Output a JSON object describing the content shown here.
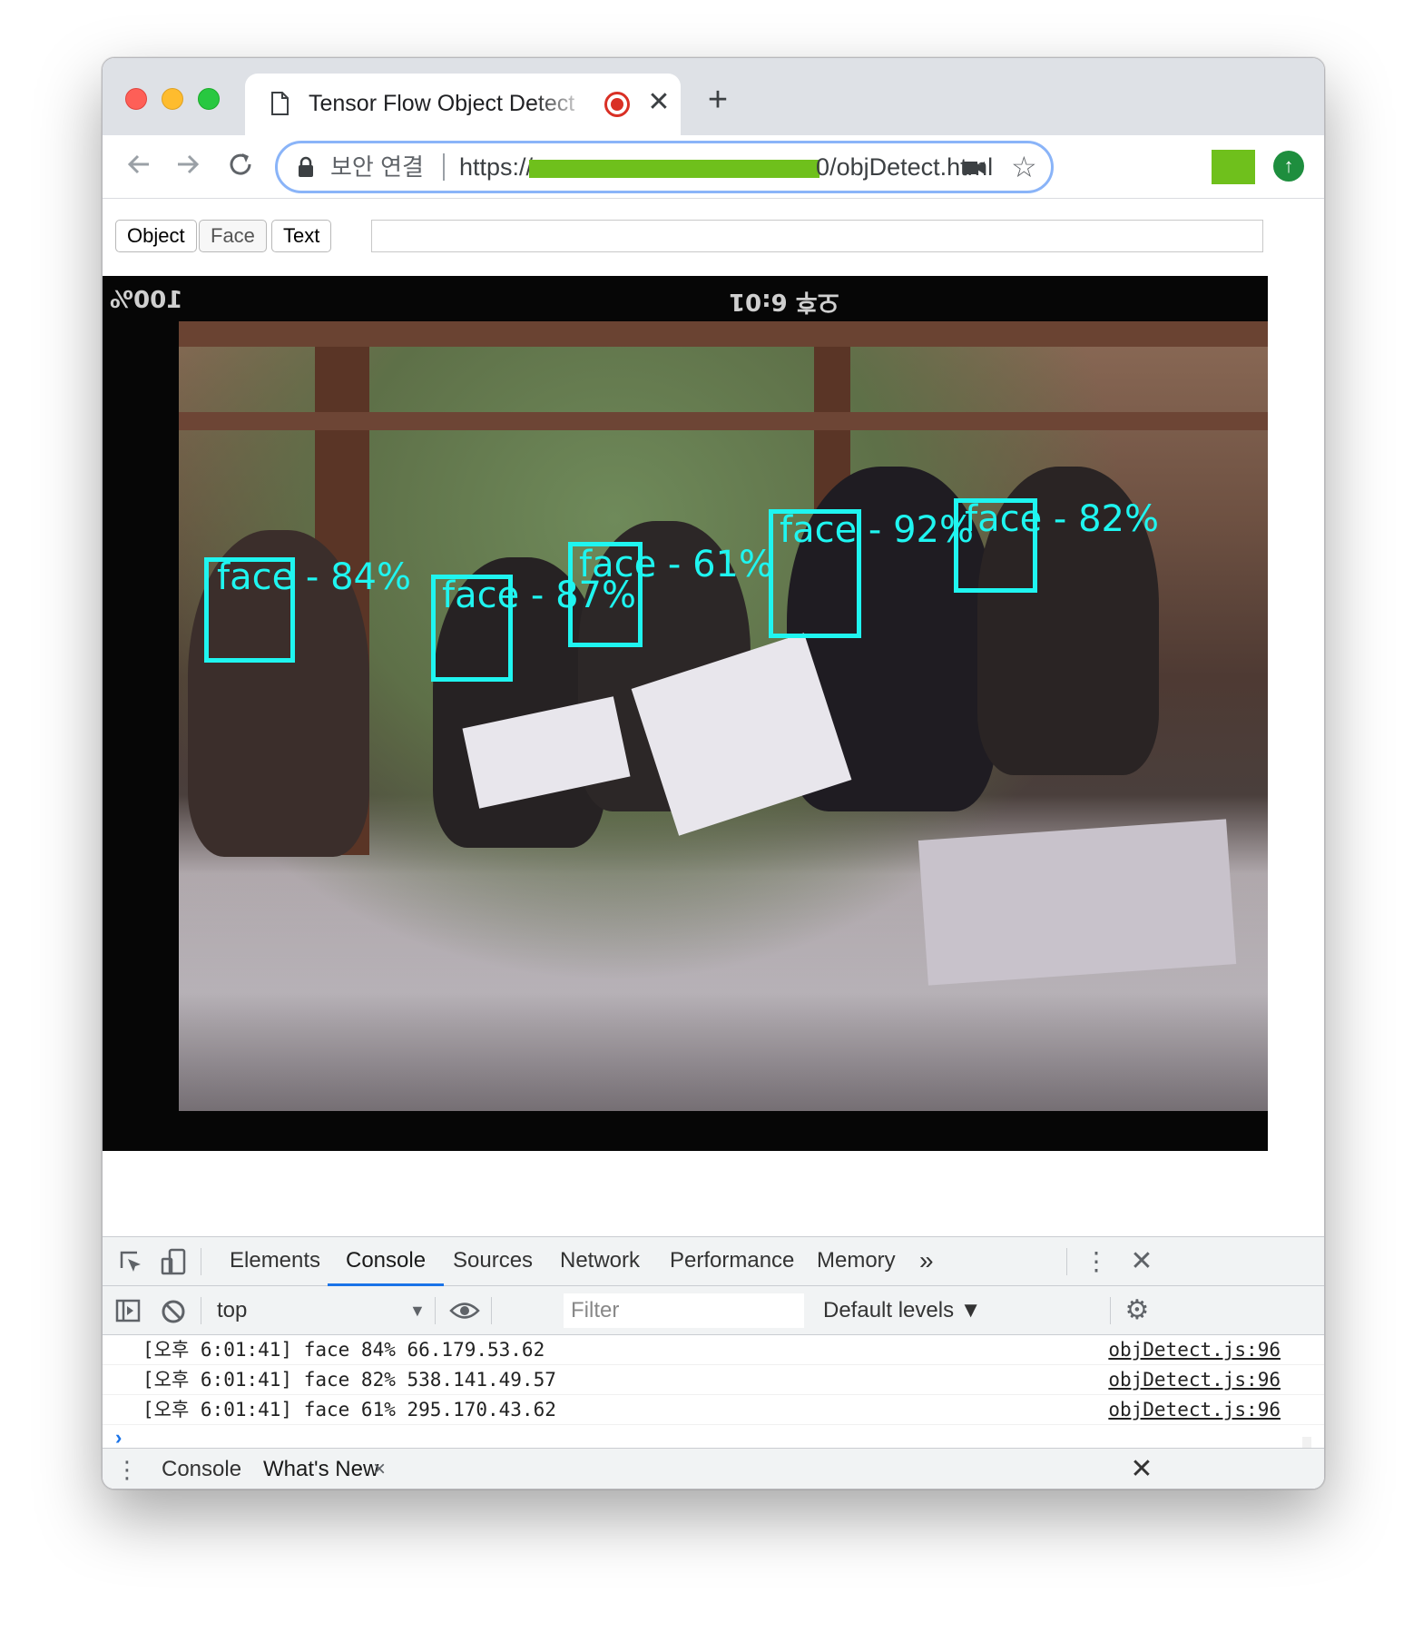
{
  "browser": {
    "tab_title": "Tensor Flow Object Detect",
    "tab_close": "✕",
    "new_tab": "+",
    "secure_label": "보안 연결",
    "url_prefix": "https://",
    "url_suffix": "0/objDetect.html",
    "accent_color": "#8ab4f8"
  },
  "page": {
    "buttons": [
      "Object",
      "Face",
      "Text"
    ],
    "input_value": "",
    "osd": {
      "battery": "100%",
      "clock": "오후 6:01"
    },
    "detections": [
      {
        "label": "face",
        "score": "84%"
      },
      {
        "label": "face",
        "score": "87%"
      },
      {
        "label": "face",
        "score": "61%"
      },
      {
        "label": "face",
        "score": "92%"
      },
      {
        "label": "face",
        "score": "82%"
      }
    ],
    "box_color": "#1ff5f0"
  },
  "devtools": {
    "tabs": [
      "Elements",
      "Console",
      "Sources",
      "Network",
      "Performance",
      "Memory"
    ],
    "active_tab": "Console",
    "more": "»",
    "context": "top",
    "filter_placeholder": "Filter",
    "levels": "Default levels ▼",
    "logs": [
      {
        "message": "[오후 6:01:41] face 84% 66.179.53.62",
        "source": "objDetect.js:96"
      },
      {
        "message": "[오후 6:01:41] face 82% 538.141.49.57",
        "source": "objDetect.js:96"
      },
      {
        "message": "[오후 6:01:41] face 61% 295.170.43.62",
        "source": "objDetect.js:96"
      }
    ],
    "drawer_tabs": [
      "Console",
      "What's New"
    ],
    "drawer_close_tab": "×"
  }
}
